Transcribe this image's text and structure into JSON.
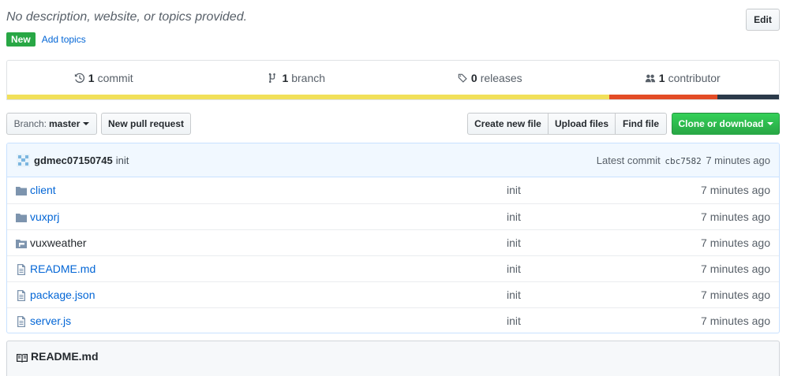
{
  "repo": {
    "description": "No description, website, or topics provided.",
    "edit_label": "Edit",
    "new_badge": "New",
    "add_topics": "Add topics"
  },
  "summary": {
    "commits": {
      "count": "1",
      "label": "commit",
      "icon": "history-icon"
    },
    "branches": {
      "count": "1",
      "label": "branch",
      "icon": "branch-icon"
    },
    "releases": {
      "count": "0",
      "label": "releases",
      "icon": "tag-icon"
    },
    "contributors": {
      "count": "1",
      "label": "contributor",
      "icon": "people-icon"
    },
    "language_colors": [
      "#f1e05a",
      "#e34c26",
      "#2b3a4a"
    ],
    "language_shares": [
      0.78,
      0.14,
      0.08
    ]
  },
  "actions": {
    "branch_prefix": "Branch:",
    "branch_name": "master",
    "new_pull_request": "New pull request",
    "create_new_file": "Create new file",
    "upload_files": "Upload files",
    "find_file": "Find file",
    "clone_download": "Clone or download"
  },
  "commit": {
    "author": "gdmec07150745",
    "message": "init",
    "latest_label": "Latest commit",
    "sha": "cbc7582",
    "age": "7 minutes ago"
  },
  "files": [
    {
      "name": "client",
      "type": "folder",
      "message": "init",
      "age": "7 minutes ago"
    },
    {
      "name": "vuxprj",
      "type": "folder",
      "message": "init",
      "age": "7 minutes ago"
    },
    {
      "name": "vuxweather",
      "type": "submodule",
      "message": "init",
      "age": "7 minutes ago"
    },
    {
      "name": "README.md",
      "type": "file",
      "message": "init",
      "age": "7 minutes ago"
    },
    {
      "name": "package.json",
      "type": "file",
      "message": "init",
      "age": "7 minutes ago"
    },
    {
      "name": "server.js",
      "type": "file",
      "message": "init",
      "age": "7 minutes ago"
    }
  ],
  "readme": {
    "title": "README.md",
    "icon": "book-icon"
  },
  "colors": {
    "link": "#0366d6",
    "green": "#28a745",
    "commit_bg": "#f1f8ff"
  }
}
